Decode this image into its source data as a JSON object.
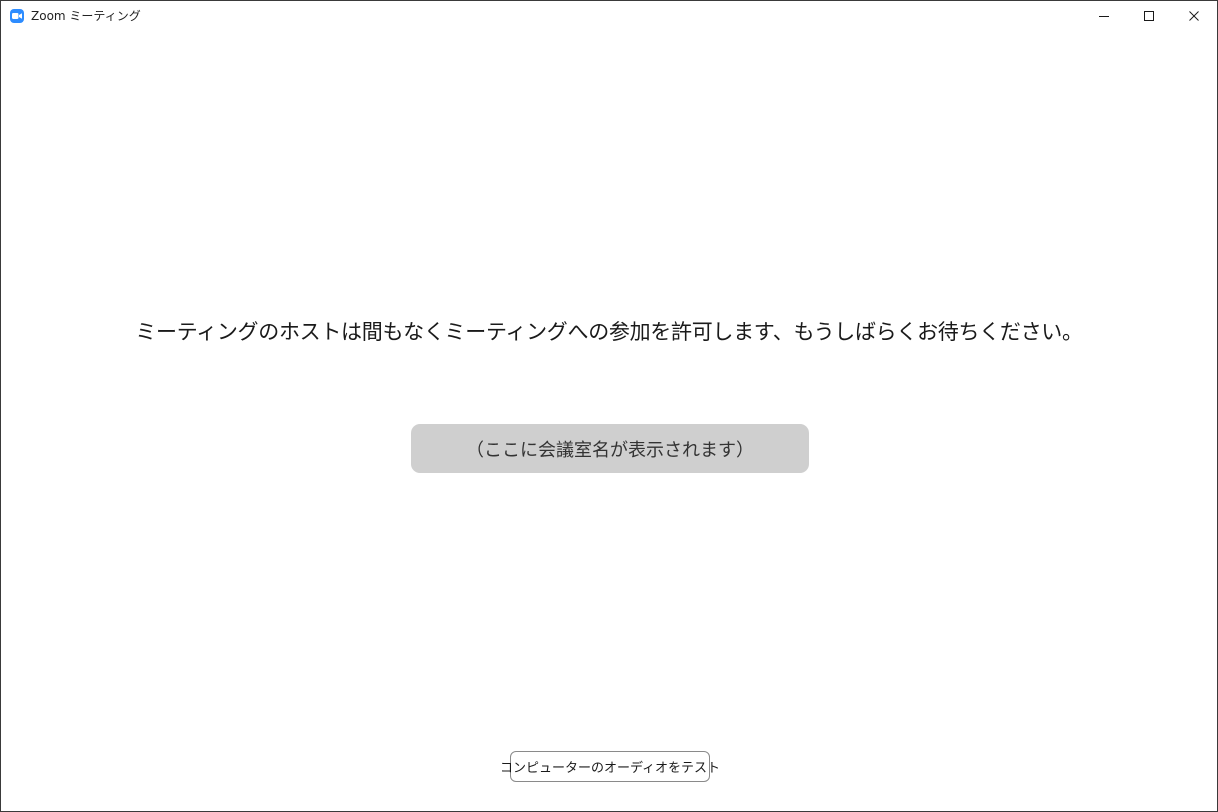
{
  "window": {
    "title": "Zoom ミーティング",
    "app_icon": "zoom-camera-icon",
    "controls": {
      "minimize_icon": "minimize-icon",
      "maximize_icon": "maximize-icon",
      "close_icon": "close-icon"
    }
  },
  "main": {
    "waiting_message": "ミーティングのホストは間もなくミーティングへの参加を許可します、もうしばらくお待ちください。",
    "meeting_name": "（ここに会議室名が表示されます）",
    "audio_test_label": "コンピューターのオーディオをテスト"
  },
  "colors": {
    "accent": "#2d8cff",
    "meeting_name_bg": "#cfcfcf"
  }
}
